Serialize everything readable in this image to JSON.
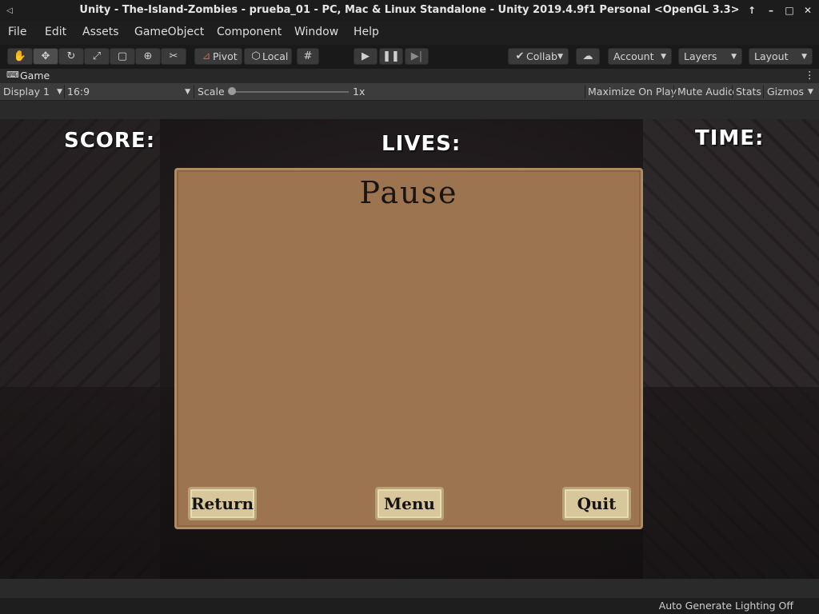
{
  "window": {
    "title": "Unity - The-Island-Zombies - prueba_01 - PC, Mac & Linux Standalone - Unity 2019.4.9f1 Personal <OpenGL 3.3>",
    "controls": [
      "arrow-up-icon",
      "minimize-icon",
      "maximize-icon",
      "close-icon"
    ]
  },
  "menu": [
    "File",
    "Edit",
    "Assets",
    "GameObject",
    "Component",
    "Window",
    "Help"
  ],
  "toolbar": {
    "tools": [
      "hand-icon",
      "move-icon",
      "rotate-icon",
      "scale-icon",
      "rect-icon",
      "transform-icon",
      "custom-tool-icon"
    ],
    "pivot_label": "Pivot",
    "local_label": "Local",
    "collab_label": "Collab",
    "account_label": "Account",
    "layers_label": "Layers",
    "layout_label": "Layout"
  },
  "game_tab": {
    "label": "Game",
    "display": "Display 1",
    "aspect": "16:9",
    "scale_label": "Scale",
    "scale_value": "1x",
    "maximize": "Maximize On Play",
    "mute": "Mute Audio",
    "stats": "Stats",
    "gizmos": "Gizmos"
  },
  "hud": {
    "score": "SCORE:",
    "lives": "LIVES:",
    "time": "TIME:"
  },
  "pause_panel": {
    "title": "Pause",
    "return": "Return",
    "menu": "Menu",
    "quit": "Quit"
  },
  "status": {
    "lighting": "Auto Generate Lighting Off"
  }
}
